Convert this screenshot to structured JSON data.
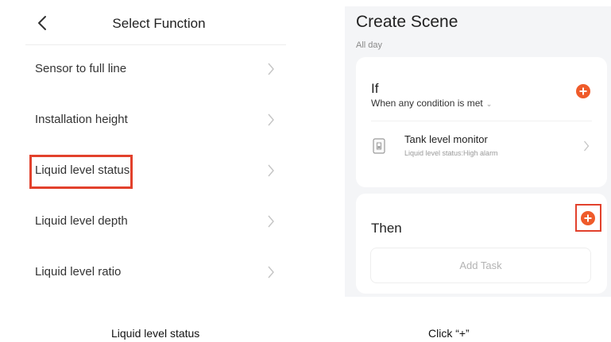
{
  "left_panel": {
    "title": "Select Function",
    "items": [
      {
        "label": "Sensor to full line"
      },
      {
        "label": "Installation height"
      },
      {
        "label": "Liquid level status"
      },
      {
        "label": "Liquid level depth"
      },
      {
        "label": "Liquid level ratio"
      }
    ],
    "highlighted_item": "Liquid level status"
  },
  "right_panel": {
    "title": "Create Scene",
    "subtitle": "All day",
    "if_card": {
      "heading": "If",
      "condition_mode": "When any condition is met",
      "condition": {
        "title": "Tank level monitor",
        "detail": "Liquid level status:High alarm"
      }
    },
    "then_card": {
      "heading": "Then",
      "add_task_label": "Add Task"
    }
  },
  "captions": {
    "left": "Liquid level status",
    "right": "Click “+”"
  },
  "colors": {
    "accent": "#ef5b2a",
    "highlight": "#e2412c"
  }
}
